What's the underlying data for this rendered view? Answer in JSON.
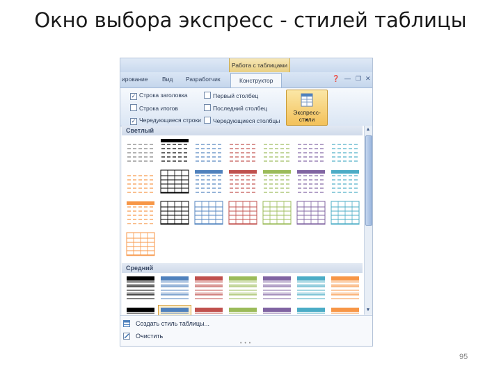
{
  "slide": {
    "title": "Окно выбора экспресс - стилей таблицы",
    "page_number": "95"
  },
  "ribbon": {
    "context_group": "Работа с таблицами",
    "tabs": [
      "ирование",
      "Вид",
      "Разработчик",
      "Конструктор"
    ],
    "active_tab": "Конструктор",
    "options_left": [
      "Строка заголовка",
      "Строка итогов",
      "Чередующиеся строки"
    ],
    "options_right": [
      "Первый столбец",
      "Последний столбец",
      "Чередующиеся столбцы"
    ],
    "express_button": {
      "label": "Экспресс-стили",
      "arrow": "▾"
    }
  },
  "gallery": {
    "sections": [
      {
        "label": "Светлый",
        "rows": [
          [
            {
              "color": "#7f7f7f",
              "style": "plain"
            },
            {
              "color": "#000000",
              "style": "header"
            },
            {
              "color": "#4f81bd",
              "style": "plain"
            },
            {
              "color": "#c0504d",
              "style": "plain"
            },
            {
              "color": "#9bbb59",
              "style": "plain"
            },
            {
              "color": "#8064a2",
              "style": "plain"
            },
            {
              "color": "#4bacc6",
              "style": "plain"
            }
          ],
          [
            {
              "color": "#f79646",
              "style": "plain"
            },
            {
              "color": "#000000",
              "style": "grid"
            },
            {
              "color": "#4f81bd",
              "style": "header"
            },
            {
              "color": "#c0504d",
              "style": "header"
            },
            {
              "color": "#9bbb59",
              "style": "header"
            },
            {
              "color": "#8064a2",
              "style": "header"
            },
            {
              "color": "#4bacc6",
              "style": "header"
            }
          ],
          [
            {
              "color": "#f79646",
              "style": "header"
            },
            {
              "color": "#000000",
              "style": "grid"
            },
            {
              "color": "#4f81bd",
              "style": "grid"
            },
            {
              "color": "#c0504d",
              "style": "grid"
            },
            {
              "color": "#9bbb59",
              "style": "grid"
            },
            {
              "color": "#8064a2",
              "style": "grid"
            },
            {
              "color": "#4bacc6",
              "style": "grid"
            }
          ],
          [
            {
              "color": "#f79646",
              "style": "grid"
            }
          ]
        ]
      },
      {
        "label": "Средний",
        "rows": [
          [
            {
              "color": "#000000",
              "style": "dark"
            },
            {
              "color": "#4f81bd",
              "style": "dark"
            },
            {
              "color": "#c0504d",
              "style": "dark"
            },
            {
              "color": "#9bbb59",
              "style": "dark"
            },
            {
              "color": "#8064a2",
              "style": "dark"
            },
            {
              "color": "#4bacc6",
              "style": "dark"
            },
            {
              "color": "#f79646",
              "style": "dark"
            }
          ],
          [
            {
              "color": "#000000",
              "style": "dark"
            },
            {
              "color": "#4f81bd",
              "style": "dark",
              "selected": true
            },
            {
              "color": "#c0504d",
              "style": "dark"
            },
            {
              "color": "#9bbb59",
              "style": "dark"
            },
            {
              "color": "#8064a2",
              "style": "dark"
            },
            {
              "color": "#4bacc6",
              "style": "dark"
            },
            {
              "color": "#f79646",
              "style": "dark"
            }
          ]
        ]
      }
    ]
  },
  "menu": {
    "items": [
      {
        "label": "Создать стиль таблицы...",
        "icon": "new-table-style-icon"
      },
      {
        "label": "Очистить",
        "icon": "clear-icon"
      }
    ]
  },
  "colors": {
    "accent": "#f3c15a",
    "ribbon": "#dbe6f4",
    "selection": "#d69d3a"
  }
}
